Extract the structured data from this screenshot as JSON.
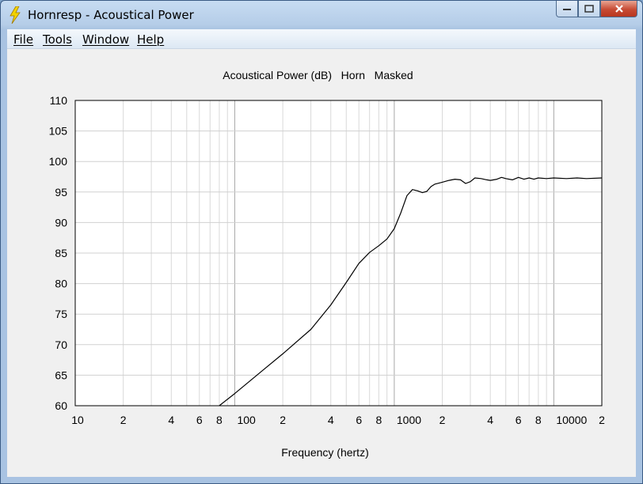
{
  "window": {
    "title": "Hornresp - Acoustical Power",
    "minimize_icon": "minimize-icon",
    "maximize_icon": "maximize-icon",
    "close_icon": "close-icon",
    "app_icon": "lightning-bolt-icon"
  },
  "menu": [
    {
      "key": "file",
      "label": "File"
    },
    {
      "key": "tools",
      "label": "Tools"
    },
    {
      "key": "window",
      "label": "Window"
    },
    {
      "key": "help",
      "label": "Help"
    }
  ],
  "chart_data": {
    "type": "line",
    "title": "Acoustical Power (dB)   Horn   Masked",
    "xlabel": "Frequency (hertz)",
    "ylabel": "",
    "xscale": "log",
    "xlim": [
      10,
      20000
    ],
    "ylim": [
      60,
      110
    ],
    "grid": true,
    "yticks": [
      60,
      65,
      70,
      75,
      80,
      85,
      90,
      95,
      100,
      105,
      110
    ],
    "xtick_labels": [
      {
        "x": 10,
        "label": "10"
      },
      {
        "x": 20,
        "label": "2"
      },
      {
        "x": 40,
        "label": "4"
      },
      {
        "x": 60,
        "label": "6"
      },
      {
        "x": 80,
        "label": "8"
      },
      {
        "x": 100,
        "label": "100"
      },
      {
        "x": 200,
        "label": "2"
      },
      {
        "x": 400,
        "label": "4"
      },
      {
        "x": 600,
        "label": "6"
      },
      {
        "x": 800,
        "label": "8"
      },
      {
        "x": 1000,
        "label": "1000"
      },
      {
        "x": 2000,
        "label": "2"
      },
      {
        "x": 4000,
        "label": "4"
      },
      {
        "x": 6000,
        "label": "6"
      },
      {
        "x": 8000,
        "label": "8"
      },
      {
        "x": 10000,
        "label": "10000"
      },
      {
        "x": 20000,
        "label": "2"
      }
    ],
    "series": [
      {
        "color": "#000000",
        "points": [
          [
            80,
            60.0
          ],
          [
            100,
            62.0
          ],
          [
            150,
            65.8
          ],
          [
            200,
            68.5
          ],
          [
            300,
            72.5
          ],
          [
            400,
            76.5
          ],
          [
            500,
            80.2
          ],
          [
            600,
            83.3
          ],
          [
            700,
            85.1
          ],
          [
            800,
            86.2
          ],
          [
            900,
            87.3
          ],
          [
            1000,
            89.0
          ],
          [
            1100,
            91.6
          ],
          [
            1200,
            94.4
          ],
          [
            1300,
            95.4
          ],
          [
            1400,
            95.2
          ],
          [
            1500,
            94.9
          ],
          [
            1600,
            95.1
          ],
          [
            1700,
            95.9
          ],
          [
            1800,
            96.3
          ],
          [
            2000,
            96.6
          ],
          [
            2200,
            96.9
          ],
          [
            2400,
            97.1
          ],
          [
            2600,
            97.0
          ],
          [
            2800,
            96.4
          ],
          [
            3000,
            96.7
          ],
          [
            3200,
            97.3
          ],
          [
            3500,
            97.2
          ],
          [
            3800,
            97.0
          ],
          [
            4000,
            96.9
          ],
          [
            4400,
            97.1
          ],
          [
            4700,
            97.4
          ],
          [
            5000,
            97.2
          ],
          [
            5500,
            97.0
          ],
          [
            6000,
            97.4
          ],
          [
            6500,
            97.1
          ],
          [
            7000,
            97.3
          ],
          [
            7500,
            97.1
          ],
          [
            8000,
            97.3
          ],
          [
            9000,
            97.2
          ],
          [
            10000,
            97.3
          ],
          [
            12000,
            97.2
          ],
          [
            14000,
            97.3
          ],
          [
            16000,
            97.2
          ],
          [
            20000,
            97.3
          ]
        ]
      }
    ]
  }
}
